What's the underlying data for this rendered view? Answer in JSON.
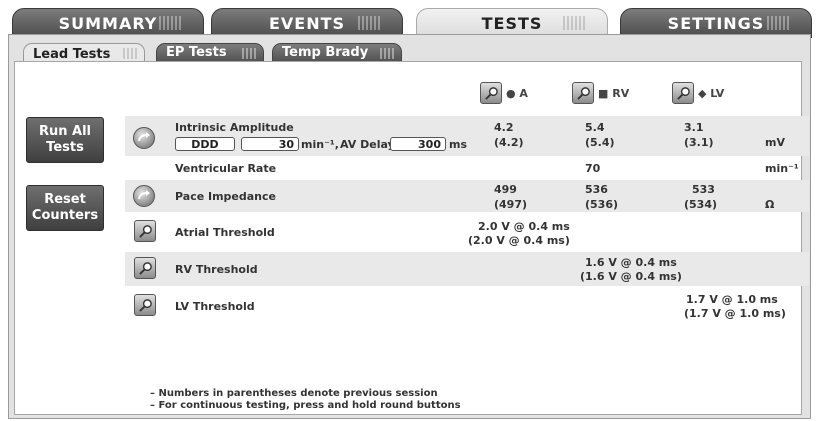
{
  "top_tabs": [
    "SUMMARY",
    "EVENTS",
    "TESTS",
    "SETTINGS"
  ],
  "sub_tabs": [
    "Lead Tests",
    "EP Tests",
    "Temp Brady"
  ],
  "columns": {
    "a": "● A",
    "rv": "■ RV",
    "lv": "◆ LV"
  },
  "buttons": {
    "run_all": "Run All Tests",
    "reset": "Reset Counters"
  },
  "intrinsic": {
    "label": "Intrinsic Amplitude",
    "mode": "DDD",
    "rate_value": "30",
    "rate_unit": "min⁻¹,",
    "av_delay_label": "AV Delay",
    "av_delay_value": "300",
    "av_delay_unit": "ms",
    "a": "4.2",
    "a_prev": "(4.2)",
    "rv": "5.4",
    "rv_prev": "(5.4)",
    "lv": "3.1",
    "lv_prev": "(3.1)",
    "unit": "mV"
  },
  "ventricular": {
    "label": "Ventricular Rate",
    "rv": "70",
    "unit": "min⁻¹"
  },
  "impedance": {
    "label": "Pace Impedance",
    "a": "499",
    "a_prev": "(497)",
    "rv": "536",
    "rv_prev": "(536)",
    "lv": "533",
    "lv_prev": "(534)",
    "unit": "Ω"
  },
  "atrial_threshold": {
    "label": "Atrial Threshold",
    "value": "2.0 V @ 0.4 ms",
    "prev": "(2.0 V @ 0.4 ms)"
  },
  "rv_threshold": {
    "label": "RV Threshold",
    "value": "1.6 V @ 0.4 ms",
    "prev": "(1.6 V @ 0.4 ms)"
  },
  "lv_threshold": {
    "label": "LV Threshold",
    "value": "1.7 V @ 1.0 ms",
    "prev": "(1.7 V @ 1.0 ms)"
  },
  "notes": [
    "– Numbers in parentheses denote previous session",
    "– For continuous testing, press and hold round buttons"
  ]
}
